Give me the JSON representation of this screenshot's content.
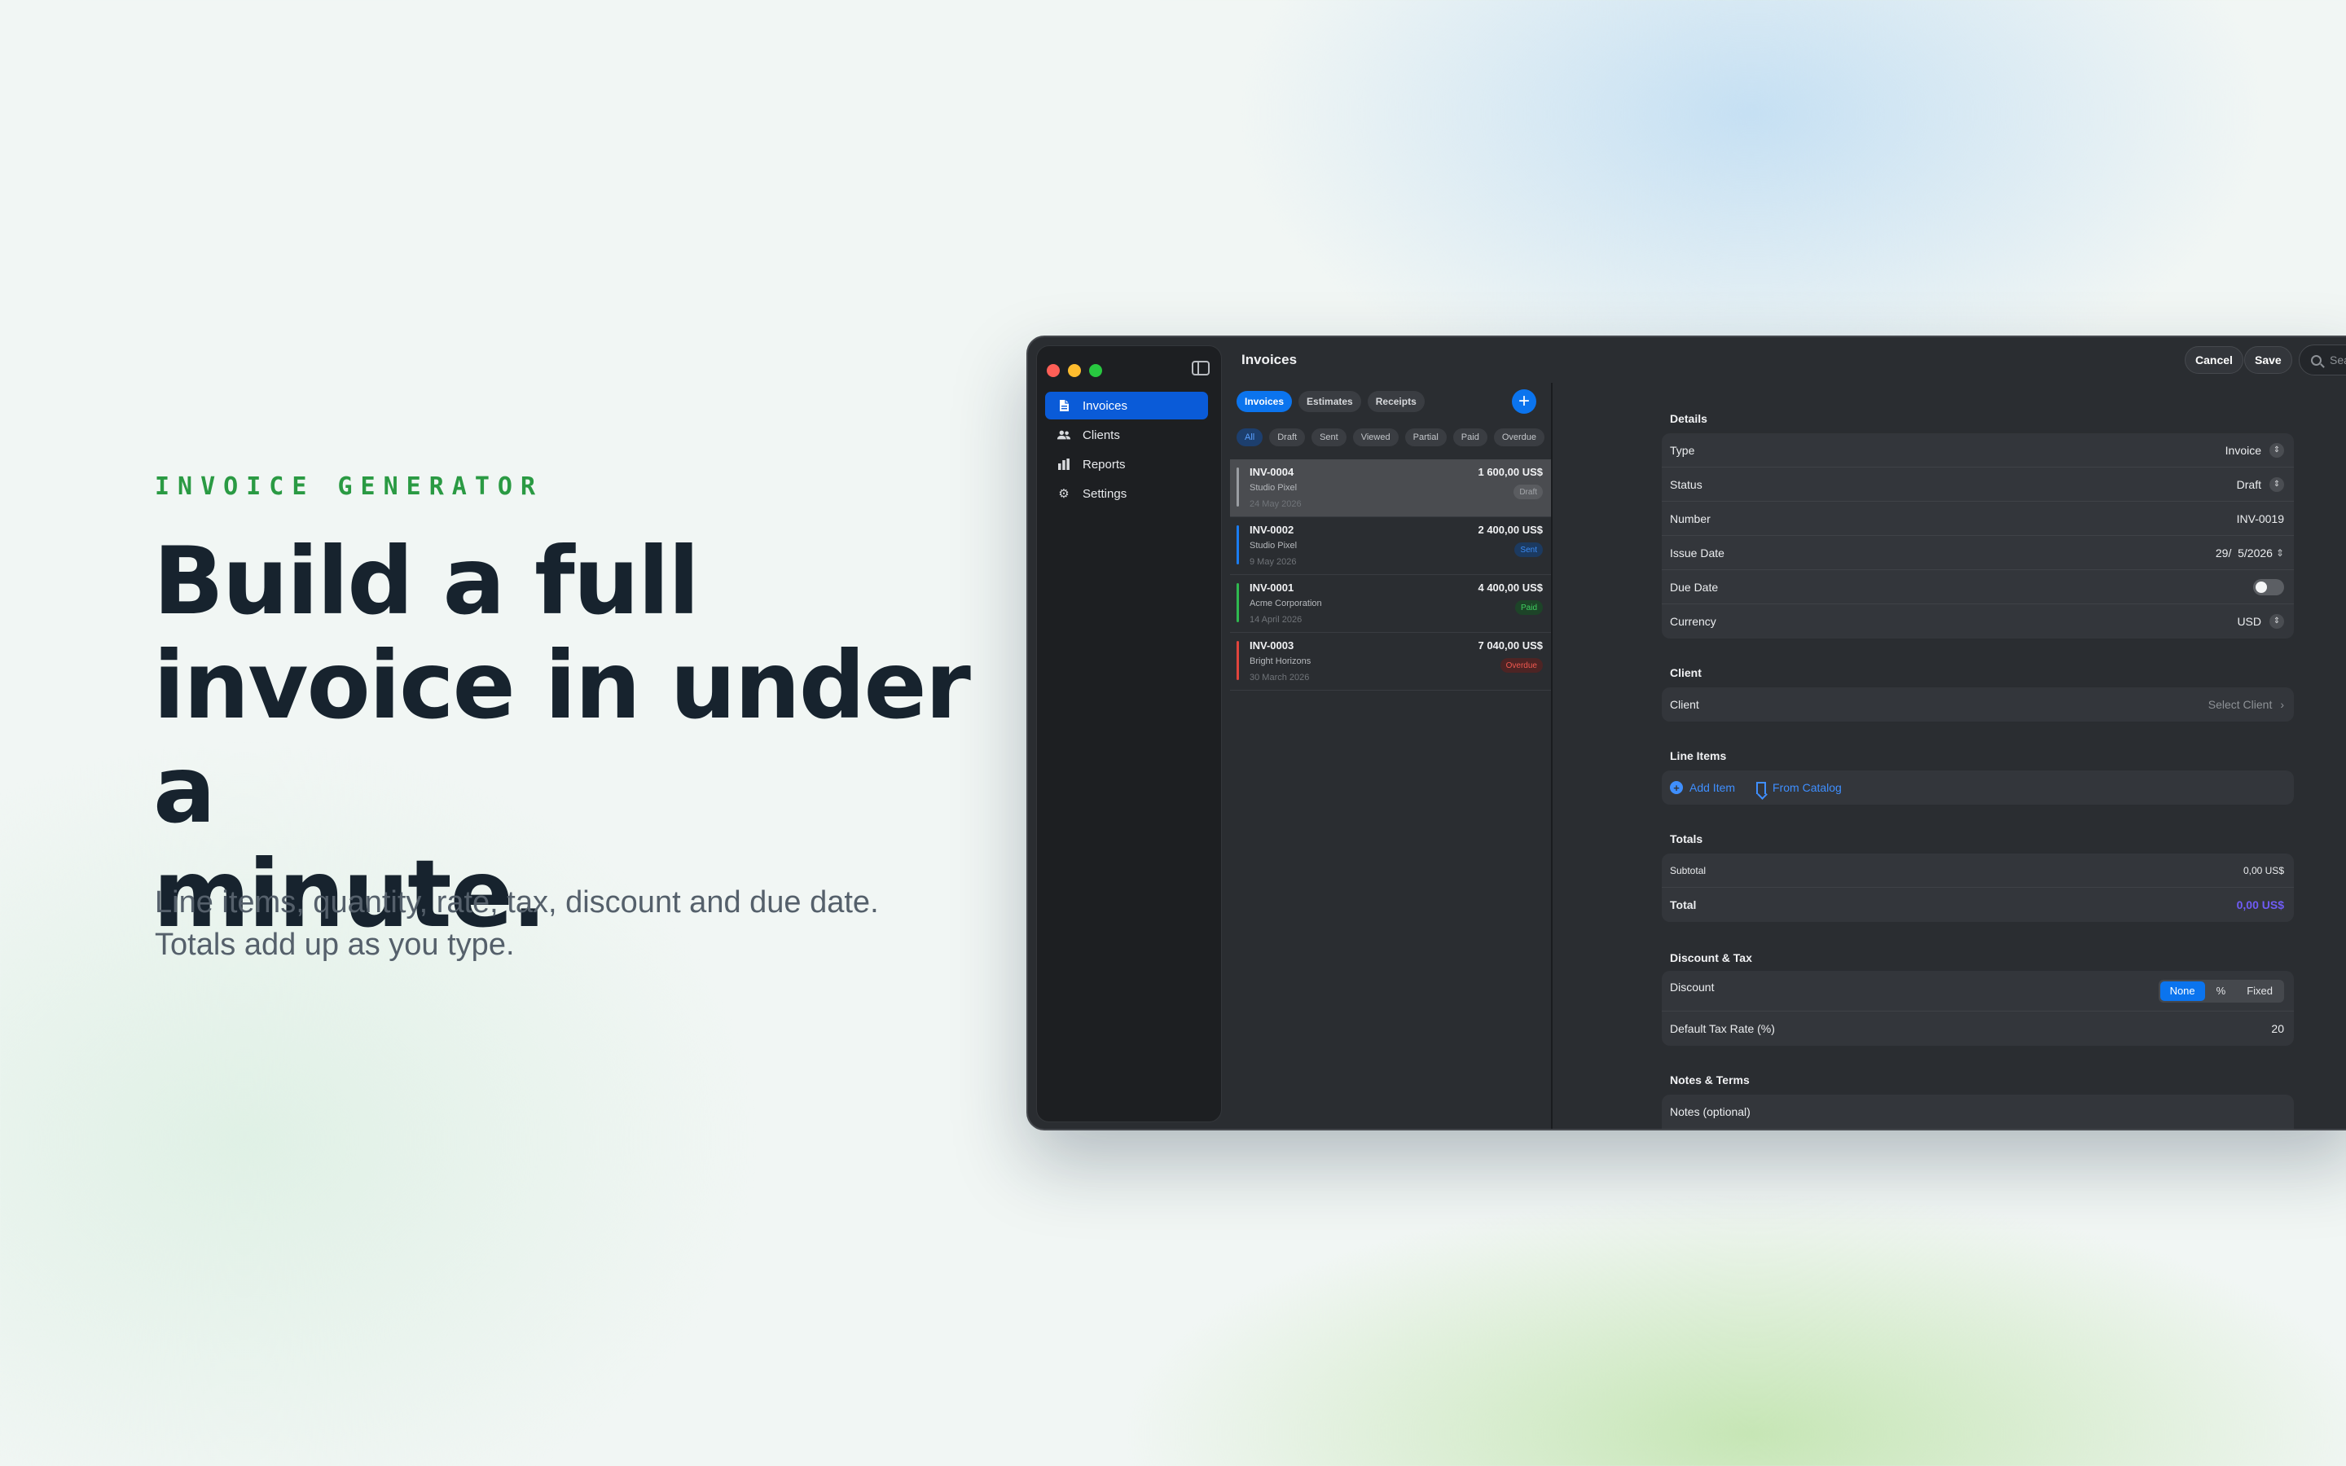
{
  "hero": {
    "eyebrow": "INVOICE GENERATOR",
    "headline_line1": "Build a full",
    "headline_line2": "invoice in under a",
    "headline_line3": "minute.",
    "sub_line1": "Line items, quantity, rate, tax, discount and due date.",
    "sub_line2": "Totals add up as you type."
  },
  "app": {
    "title": "Invoices",
    "cancel_label": "Cancel",
    "save_label": "Save",
    "search_placeholder": "Search by number or client"
  },
  "sidebar": {
    "items": [
      {
        "label": "Invoices",
        "icon": "document-icon"
      },
      {
        "label": "Clients",
        "icon": "people-icon"
      },
      {
        "label": "Reports",
        "icon": "bar-chart-icon"
      },
      {
        "label": "Settings",
        "icon": "gear-icon"
      }
    ]
  },
  "list": {
    "tabs": [
      "Invoices",
      "Estimates",
      "Receipts"
    ],
    "filters": [
      "All",
      "Draft",
      "Sent",
      "Viewed",
      "Partial",
      "Paid",
      "Overdue"
    ],
    "rows": [
      {
        "number": "INV-0004",
        "client": "Studio Pixel",
        "date": "24 May 2026",
        "amount": "1 600,00 US$",
        "status": "Draft",
        "color": "#9a9da2",
        "badge_bg": "#5a5c60",
        "badge_fg": "#a3a6aa"
      },
      {
        "number": "INV-0002",
        "client": "Studio Pixel",
        "date": "9 May 2026",
        "amount": "2 400,00 US$",
        "status": "Sent",
        "color": "#1a7cf0",
        "badge_bg": "#1c3a60",
        "badge_fg": "#3b8cf5"
      },
      {
        "number": "INV-0001",
        "client": "Acme Corporation",
        "date": "14 April 2026",
        "amount": "4 400,00 US$",
        "status": "Paid",
        "color": "#2fb84f",
        "badge_bg": "#1d4428",
        "badge_fg": "#3fcf5f"
      },
      {
        "number": "INV-0003",
        "client": "Bright Horizons",
        "date": "30 March 2026",
        "amount": "7 040,00 US$",
        "status": "Overdue",
        "color": "#e0443c",
        "badge_bg": "#4d2424",
        "badge_fg": "#f0584f"
      }
    ]
  },
  "details": {
    "title": "Details",
    "type_label": "Type",
    "type_value": "Invoice",
    "status_label": "Status",
    "status_value": "Draft",
    "number_label": "Number",
    "number_value": "INV-0019",
    "issue_label": "Issue Date",
    "issue_value": "29/  5/2026",
    "due_label": "Due Date",
    "currency_label": "Currency",
    "currency_value": "USD"
  },
  "client": {
    "title": "Client",
    "label": "Client",
    "value": "Select Client"
  },
  "line_items": {
    "title": "Line Items",
    "add_label": "Add Item",
    "catalog_label": "From Catalog"
  },
  "totals": {
    "title": "Totals",
    "subtotal_label": "Subtotal",
    "subtotal_value": "0,00 US$",
    "total_label": "Total",
    "total_value": "0,00 US$",
    "total_color": "#6f5cf6"
  },
  "discount_tax": {
    "title": "Discount & Tax",
    "discount_label": "Discount",
    "options": [
      "None",
      "%",
      "Fixed"
    ],
    "tax_label": "Default Tax Rate (%)",
    "tax_value": "20"
  },
  "notes": {
    "title": "Notes & Terms",
    "placeholder": "Notes (optional)"
  }
}
